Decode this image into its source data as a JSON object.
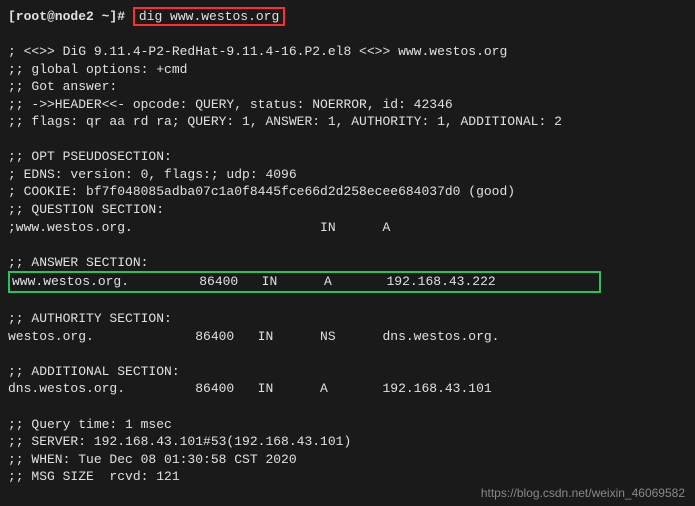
{
  "prompt": {
    "user_host": "[root@node2 ~]#",
    "command": "dig www.westos.org"
  },
  "banner": "; <<>> DiG 9.11.4-P2-RedHat-9.11.4-16.P2.el8 <<>> www.westos.org",
  "global_options": ";; global options: +cmd",
  "got_answer": ";; Got answer:",
  "header": ";; ->>HEADER<<- opcode: QUERY, status: NOERROR, id: 42346",
  "flags": ";; flags: qr aa rd ra; QUERY: 1, ANSWER: 1, AUTHORITY: 1, ADDITIONAL: 2",
  "opt_header": ";; OPT PSEUDOSECTION:",
  "edns": "; EDNS: version: 0, flags:; udp: 4096",
  "cookie": "; COOKIE: bf7f048085adba07c1a0f8445fce66d2d258ecee684037d0 (good)",
  "question_header": ";; QUESTION SECTION:",
  "question_row": ";www.westos.org.                        IN      A",
  "answer_header": ";; ANSWER SECTION:",
  "answer_row": "www.westos.org.         86400   IN      A       192.168.43.222",
  "authority_header": ";; AUTHORITY SECTION:",
  "authority_row": "westos.org.             86400   IN      NS      dns.westos.org.",
  "additional_header": ";; ADDITIONAL SECTION:",
  "additional_row": "dns.westos.org.         86400   IN      A       192.168.43.101",
  "query_time": ";; Query time: 1 msec",
  "server": ";; SERVER: 192.168.43.101#53(192.168.43.101)",
  "when": ";; WHEN: Tue Dec 08 01:30:58 CST 2020",
  "msg_size": ";; MSG SIZE  rcvd: 121",
  "watermark": "https://blog.csdn.net/weixin_46069582"
}
